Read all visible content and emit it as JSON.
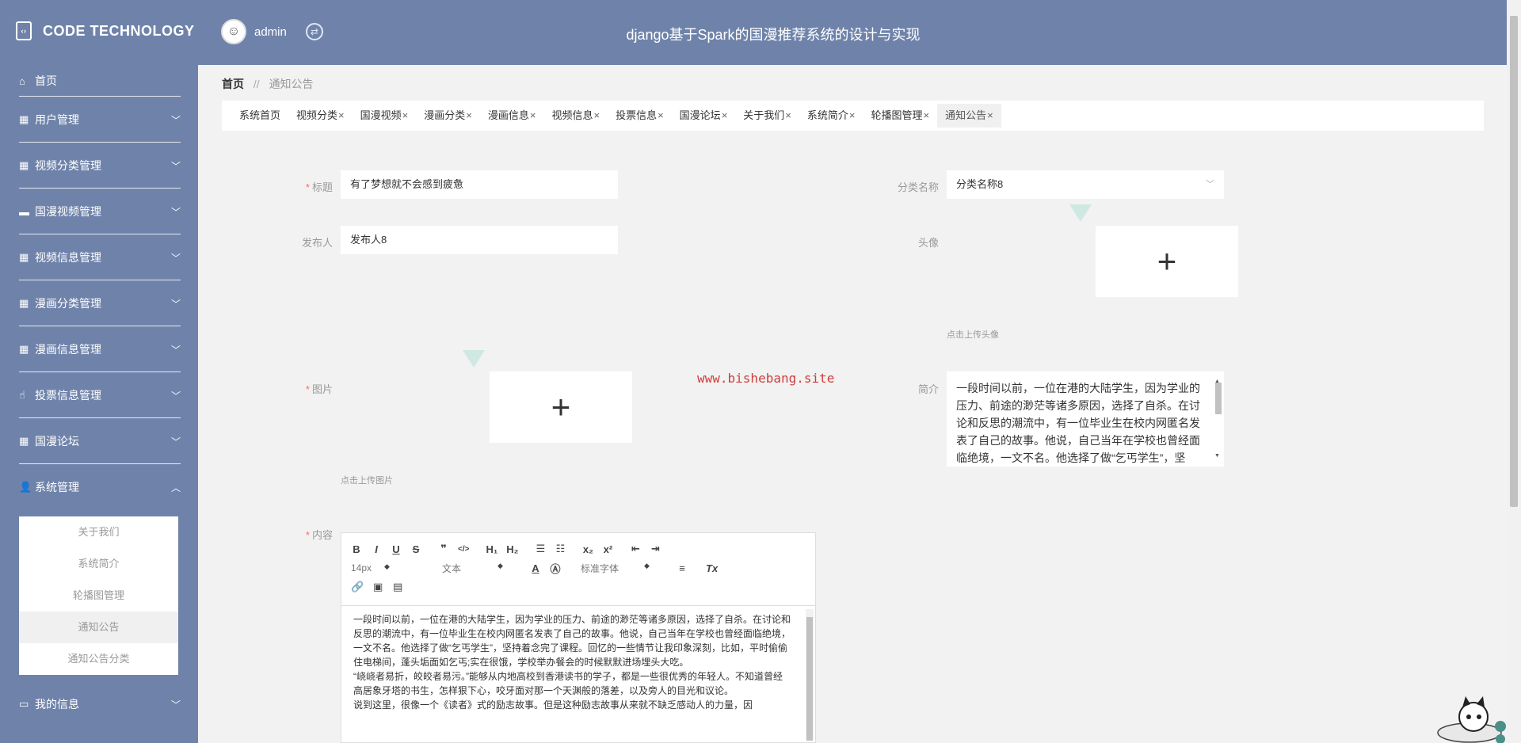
{
  "brand": {
    "name": "CODE TECHNOLOGY"
  },
  "user": {
    "name": "admin"
  },
  "site_title": "django基于Spark的国漫推荐系统的设计与实现",
  "sidebar": {
    "items": [
      {
        "label": "首页",
        "icon": "home-icon"
      },
      {
        "label": "用户管理",
        "icon": "grid-icon"
      },
      {
        "label": "视频分类管理",
        "icon": "grid-icon"
      },
      {
        "label": "国漫视频管理",
        "icon": "message-icon"
      },
      {
        "label": "视频信息管理",
        "icon": "grid-icon"
      },
      {
        "label": "漫画分类管理",
        "icon": "grid-icon"
      },
      {
        "label": "漫画信息管理",
        "icon": "grid-icon"
      },
      {
        "label": "投票信息管理",
        "icon": "thumb-icon"
      },
      {
        "label": "国漫论坛",
        "icon": "grid-icon"
      },
      {
        "label": "系统管理",
        "icon": "user-icon"
      },
      {
        "label": "我的信息",
        "icon": "card-icon"
      }
    ],
    "submenu": [
      "关于我们",
      "系统简介",
      "轮播图管理",
      "通知公告",
      "通知公告分类"
    ]
  },
  "breadcrumb": {
    "home": "首页",
    "sep": "//",
    "current": "通知公告"
  },
  "tabs": [
    {
      "label": "系统首页",
      "close": ""
    },
    {
      "label": "视频分类",
      "close": "×"
    },
    {
      "label": "国漫视频",
      "close": "×"
    },
    {
      "label": "漫画分类",
      "close": "×"
    },
    {
      "label": "漫画信息",
      "close": "×"
    },
    {
      "label": "视频信息",
      "close": "×"
    },
    {
      "label": "投票信息",
      "close": "×"
    },
    {
      "label": "国漫论坛",
      "close": "×"
    },
    {
      "label": "关于我们",
      "close": "×"
    },
    {
      "label": "系统简介",
      "close": "×"
    },
    {
      "label": "轮播图管理",
      "close": "×"
    },
    {
      "label": "通知公告",
      "close": "×"
    }
  ],
  "form": {
    "title_label": "标题",
    "title_value": "有了梦想就不会感到疲惫",
    "category_label": "分类名称",
    "category_value": "分类名称8",
    "publisher_label": "发布人",
    "publisher_value": "发布人8",
    "avatar_label": "头像",
    "avatar_tip": "点击上传头像",
    "image_label": "图片",
    "image_tip": "点击上传图片",
    "intro_label": "简介",
    "intro_value": "一段时间以前，一位在港的大陆学生，因为学业的压力、前途的渺茫等诸多原因，选择了自杀。在讨论和反思的潮流中，有一位毕业生在校内网匿名发表了自己的故事。他说，自己当年在学校也曾经面临绝境，一文不名。他选择了做“乞丐学生”，坚",
    "content_label": "内容",
    "required_mark": "*"
  },
  "watermark": "www.bishebang.site",
  "editor": {
    "toolbar_row1": [
      "B",
      "I",
      "U",
      "S",
      "❞",
      "</>",
      "H₁",
      "H₂",
      "☰",
      "☷",
      "x₂",
      "x²",
      "⇤",
      "⇥"
    ],
    "size": "14px",
    "format": "文本",
    "font": "标准字体",
    "content": [
      "一段时间以前，一位在港的大陆学生，因为学业的压力、前途的渺茫等诸多原因，选择了自杀。在讨论和反思的潮流中，有一位毕业生在校内网匿名发表了自己的故事。他说，自己当年在学校也曾经面临绝境，一文不名。他选择了做“乞丐学生”，坚持着念完了课程。回忆的一些情节让我印象深刻，比如，平时偷偷住电梯间，蓬头垢面如乞丐;实在很饿，学校举办餐会的时候默默进场埋头大吃。",
      "“峣峣者易折，皎皎者易污。”能够从内地高校到香港读书的学子，都是一些很优秀的年轻人。不知道曾经高居象牙塔的书生，怎样狠下心，咬牙面对那一个天渊般的落差，以及旁人的目光和议论。",
      "说到这里，很像一个《读者》式的励志故事。但是这种励志故事从来就不缺乏感动人的力量，因"
    ]
  }
}
